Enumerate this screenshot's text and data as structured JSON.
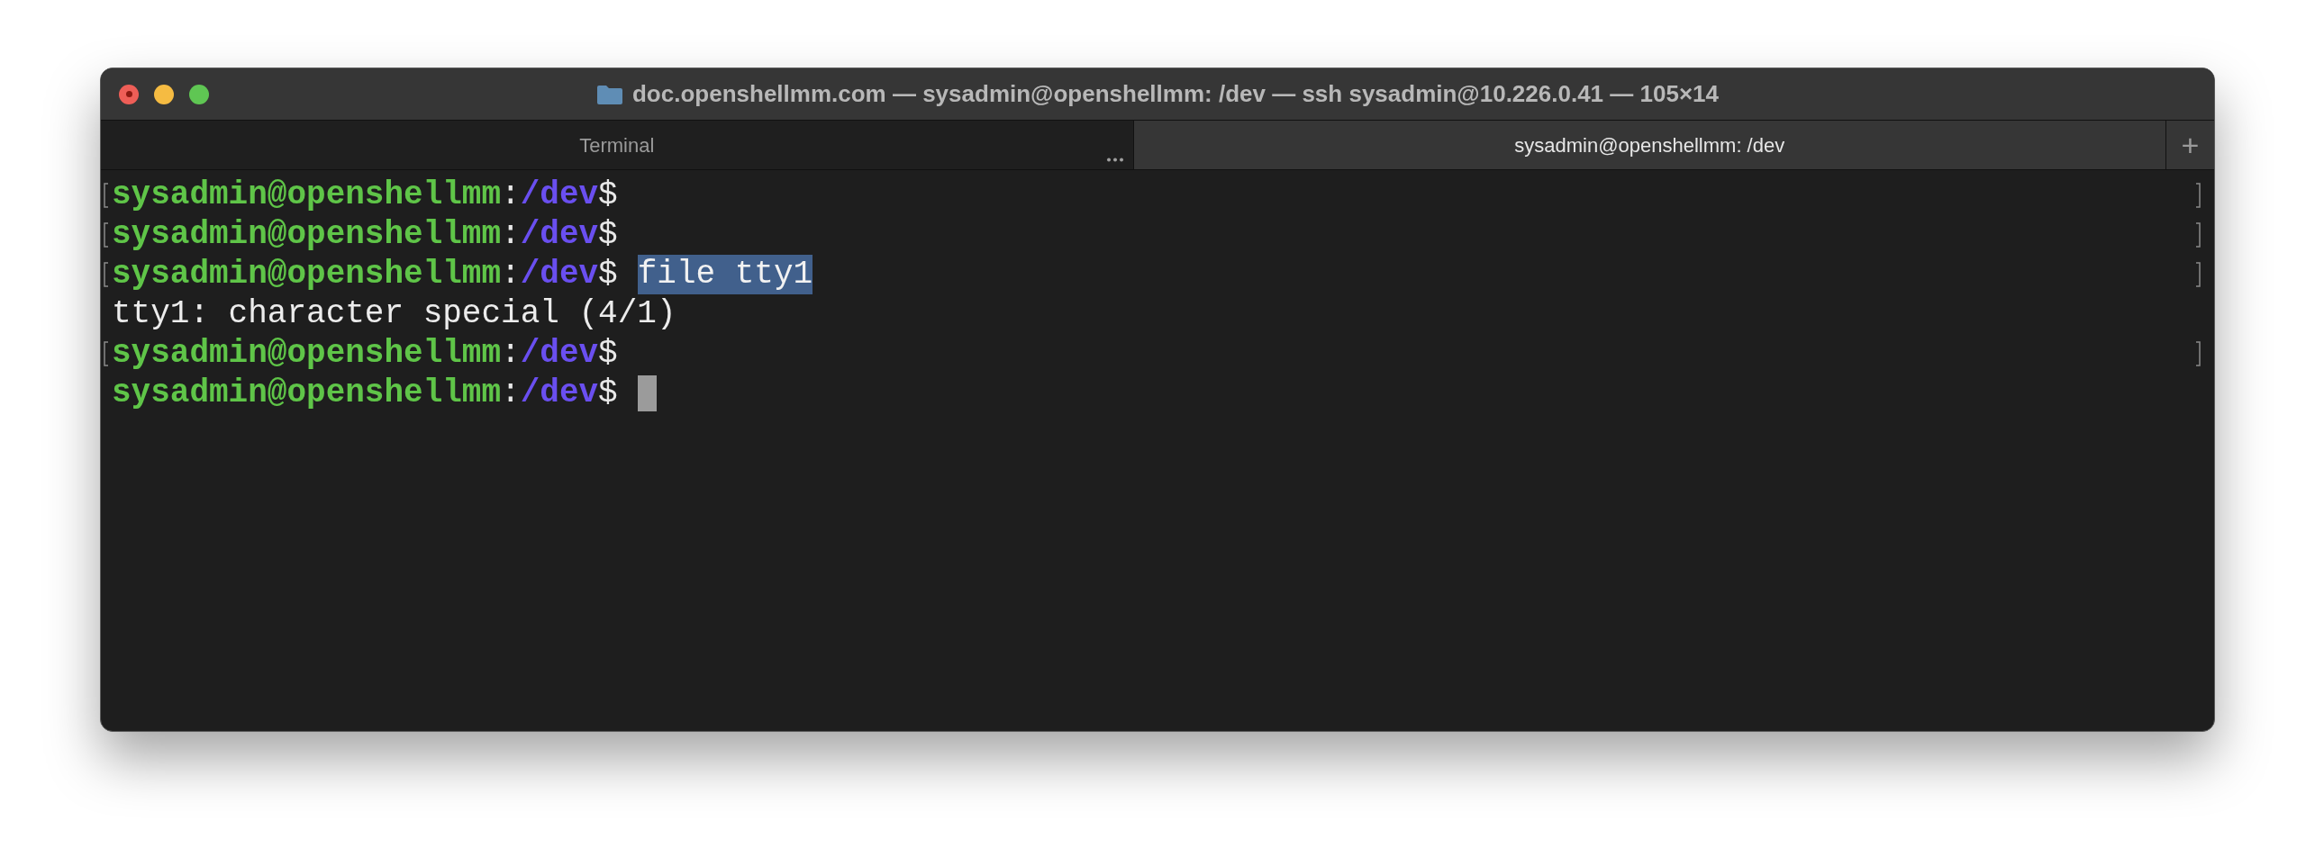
{
  "window": {
    "title": "doc.openshellmm.com — sysadmin@openshellmm: /dev — ssh sysadmin@10.226.0.41 — 105×14"
  },
  "tabs": [
    {
      "label": "Terminal",
      "selected": false
    },
    {
      "label": "sysadmin@openshellmm: /dev",
      "selected": true
    }
  ],
  "new_tab": "+",
  "lines": [
    {
      "kind": "prompt",
      "marked": true,
      "user": "sysadmin@openshellmm",
      "separator": ":",
      "path": "/dev",
      "symbol": "$",
      "cursor": false
    },
    {
      "kind": "prompt",
      "marked": true,
      "user": "sysadmin@openshellmm",
      "separator": ":",
      "path": "/dev",
      "symbol": "$",
      "cursor": false
    },
    {
      "kind": "prompt",
      "marked": true,
      "user": "sysadmin@openshellmm",
      "separator": ":",
      "path": "/dev",
      "symbol": "$",
      "command": "file tty1",
      "selected": true,
      "cursor": false
    },
    {
      "kind": "output",
      "marked": false,
      "text": "tty1: character special (4/1)"
    },
    {
      "kind": "prompt",
      "marked": true,
      "user": "sysadmin@openshellmm",
      "separator": ":",
      "path": "/dev",
      "symbol": "$",
      "cursor": false
    },
    {
      "kind": "prompt",
      "marked": false,
      "user": "sysadmin@openshellmm",
      "separator": ":",
      "path": "/dev",
      "symbol": "$",
      "cursor": true
    }
  ]
}
